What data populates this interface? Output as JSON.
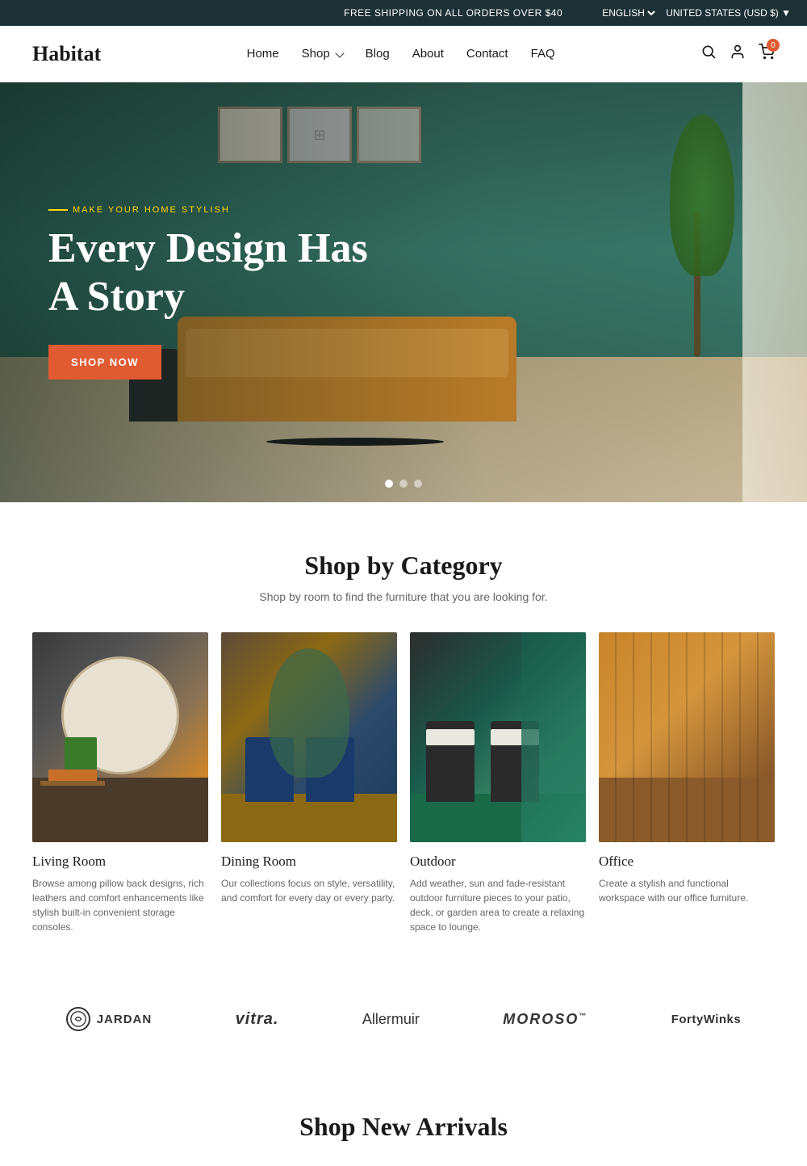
{
  "topbar": {
    "shipping_text": "FREE SHIPPING ON ALL ORDERS OVER $40",
    "language_label": "ENGLISH",
    "currency_label": "UNITED STATES (USD $)"
  },
  "header": {
    "logo": "Habitat",
    "nav": [
      {
        "label": "Home",
        "href": "#",
        "has_dropdown": false
      },
      {
        "label": "Shop",
        "href": "#",
        "has_dropdown": true
      },
      {
        "label": "Blog",
        "href": "#",
        "has_dropdown": false
      },
      {
        "label": "About",
        "href": "#",
        "has_dropdown": false
      },
      {
        "label": "Contact",
        "href": "#",
        "has_dropdown": false
      },
      {
        "label": "FAQ",
        "href": "#",
        "has_dropdown": false
      }
    ],
    "cart_count": "0"
  },
  "hero": {
    "eyebrow": "MAKE YOUR HOME STYLISH",
    "title": "Every Design Has A Story",
    "cta_label": "SHOP NOW",
    "dots": [
      {
        "active": true
      },
      {
        "active": false
      },
      {
        "active": false
      }
    ]
  },
  "shop_category": {
    "title": "Shop by Category",
    "subtitle": "Shop by room to find the furniture that you are looking for.",
    "categories": [
      {
        "name": "Living Room",
        "desc": "Browse among pillow back designs, rich leathers and comfort enhancements like stylish built-in convenient storage consoles.",
        "type": "living"
      },
      {
        "name": "Dining Room",
        "desc": "Our collections focus on style, versatility, and comfort for every day or every party.",
        "type": "dining"
      },
      {
        "name": "Outdoor",
        "desc": "Add weather, sun and fade-resistant outdoor furniture pieces to your patio, deck, or garden area to create a relaxing space to lounge.",
        "type": "outdoor"
      },
      {
        "name": "Office",
        "desc": "Create a stylish and functional workspace with our office furniture.",
        "type": "office"
      }
    ]
  },
  "brands": {
    "items": [
      {
        "label": "JARDAN",
        "class": "jardan"
      },
      {
        "label": "vitra.",
        "class": "vitra"
      },
      {
        "label": "Allermuir",
        "class": "allermuir"
      },
      {
        "label": "MOROSO",
        "class": "moroso"
      },
      {
        "label": "FortyWinks",
        "class": "fortywinks"
      }
    ]
  },
  "new_arrivals": {
    "title": "Shop New Arrivals"
  }
}
